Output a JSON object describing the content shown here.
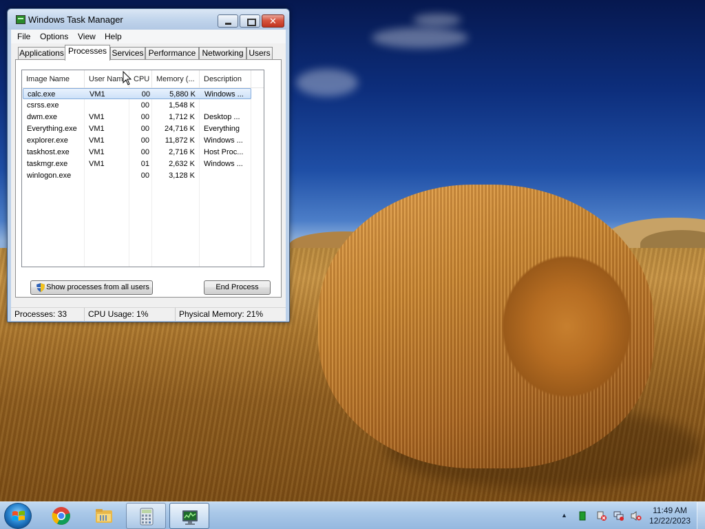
{
  "window": {
    "title": "Windows Task Manager",
    "menu": [
      "File",
      "Options",
      "View",
      "Help"
    ],
    "tabs": [
      "Applications",
      "Processes",
      "Services",
      "Performance",
      "Networking",
      "Users"
    ],
    "active_tab": "Processes"
  },
  "processes": {
    "columns": [
      "Image Name",
      "User Name",
      "CPU",
      "Memory (...",
      "Description"
    ],
    "rows": [
      {
        "image": "calc.exe",
        "user": "VM1",
        "cpu": "00",
        "memory": "5,880 K",
        "description": "Windows ...",
        "selected": true
      },
      {
        "image": "csrss.exe",
        "user": "",
        "cpu": "00",
        "memory": "1,548 K",
        "description": ""
      },
      {
        "image": "dwm.exe",
        "user": "VM1",
        "cpu": "00",
        "memory": "1,712 K",
        "description": "Desktop ..."
      },
      {
        "image": "Everything.exe",
        "user": "VM1",
        "cpu": "00",
        "memory": "24,716 K",
        "description": "Everything"
      },
      {
        "image": "explorer.exe",
        "user": "VM1",
        "cpu": "00",
        "memory": "11,872 K",
        "description": "Windows ..."
      },
      {
        "image": "taskhost.exe",
        "user": "VM1",
        "cpu": "00",
        "memory": "2,716 K",
        "description": "Host Proc..."
      },
      {
        "image": "taskmgr.exe",
        "user": "VM1",
        "cpu": "01",
        "memory": "2,632 K",
        "description": "Windows ..."
      },
      {
        "image": "winlogon.exe",
        "user": "",
        "cpu": "00",
        "memory": "3,128 K",
        "description": ""
      }
    ],
    "show_all_button": "Show processes from all users",
    "end_process_button": "End Process"
  },
  "status": {
    "processes": "Processes: 33",
    "cpu": "CPU Usage: 1%",
    "memory": "Physical Memory: 21%"
  },
  "taskbar": {
    "pinned": [
      "start-orb",
      "chrome-icon",
      "file-explorer-icon",
      "calculator-icon",
      "task-manager-icon"
    ],
    "clock_time": "11:49 AM",
    "clock_date": "12/22/2023"
  },
  "colors": {
    "selection": "#cde1f8",
    "title_bar": "#c2d5ec",
    "taskbar": "#a9c8e8"
  }
}
